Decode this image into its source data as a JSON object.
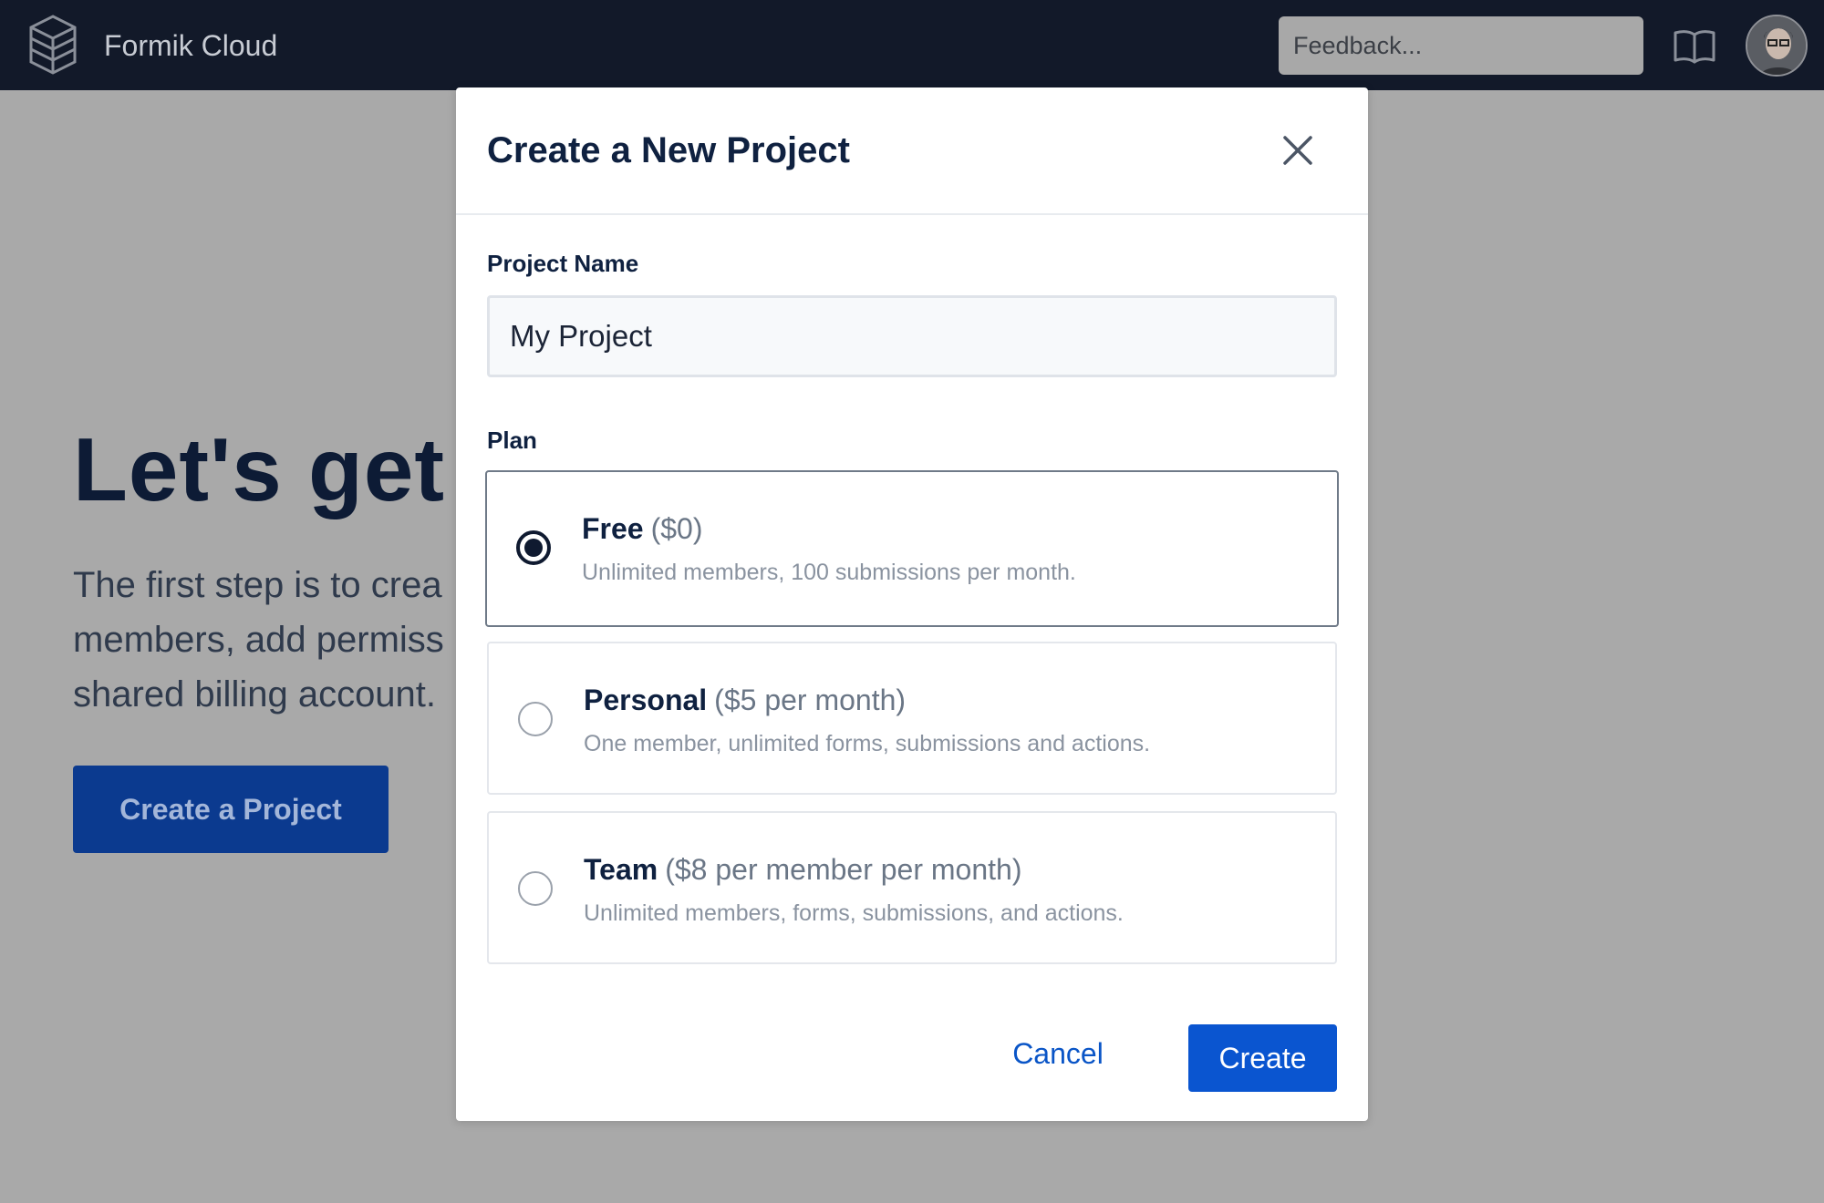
{
  "app": {
    "title": "Formik Cloud"
  },
  "header": {
    "feedback_placeholder": "Feedback...",
    "docs_icon": "book-open-icon",
    "avatar": "user-avatar"
  },
  "hero": {
    "heading": "Let's get",
    "text_line_1": "The first step is to crea",
    "text_line_2": "members, add permiss",
    "text_line_3": "shared billing account.",
    "button_label": "Create a Project"
  },
  "modal": {
    "title": "Create a New Project",
    "close_icon": "close-icon",
    "project_name_label": "Project Name",
    "project_name_value": "My Project",
    "plan_label": "Plan",
    "plans": [
      {
        "name": "Free",
        "price": "($0)",
        "description": "Unlimited members, 100 submissions per month.",
        "selected": true
      },
      {
        "name": "Personal",
        "price": "($5 per month)",
        "description": "One member, unlimited forms, submissions and actions.",
        "selected": false
      },
      {
        "name": "Team",
        "price": "($8 per member per month)",
        "description": "Unlimited members, forms, submissions, and actions.",
        "selected": false
      }
    ],
    "cancel_label": "Cancel",
    "create_label": "Create"
  },
  "colors": {
    "topbar": "#121929",
    "overlay": "#a9a9a9",
    "primary": "#0a55d0",
    "text_dark": "#0f2140"
  }
}
